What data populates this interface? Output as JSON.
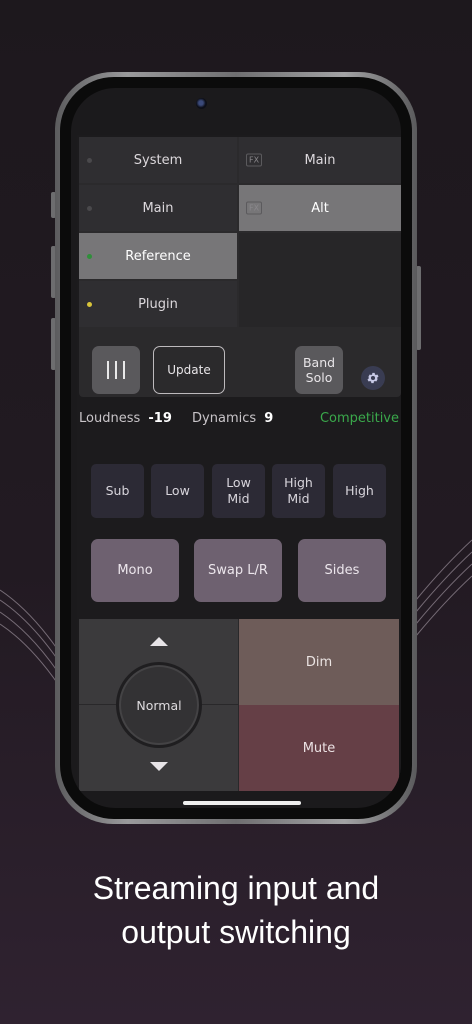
{
  "outputs": {
    "left": [
      {
        "label": "System",
        "dot": "grey"
      },
      {
        "label": "Main",
        "dot": "grey"
      },
      {
        "label": "Reference",
        "dot": "green",
        "selected": true
      },
      {
        "label": "Plugin",
        "dot": "yellow"
      }
    ],
    "right": [
      {
        "label": "Main",
        "badge": "FX"
      },
      {
        "label": "Alt",
        "badge": "FX",
        "selected": true
      }
    ]
  },
  "controls": {
    "update_label": "Update",
    "band_solo_line1": "Band",
    "band_solo_line2": "Solo"
  },
  "stats": {
    "loudness_label": "Loudness",
    "loudness_value": "-19",
    "dynamics_label": "Dynamics",
    "dynamics_value": "9",
    "profile": "Competitive"
  },
  "bands": [
    {
      "line1": "Sub",
      "line2": ""
    },
    {
      "line1": "Low",
      "line2": ""
    },
    {
      "line1": "Low",
      "line2": "Mid"
    },
    {
      "line1": "High",
      "line2": "Mid"
    },
    {
      "line1": "High",
      "line2": ""
    }
  ],
  "modes": [
    "Mono",
    "Swap L/R",
    "Sides"
  ],
  "volume": {
    "knob_label": "Normal"
  },
  "actions": {
    "dim_label": "Dim",
    "mute_label": "Mute"
  },
  "caption": {
    "line1": "Streaming input and",
    "line2": "output switching"
  },
  "colors": {
    "accent_green": "#3aa84b",
    "dim": "#6e5c59",
    "mute": "#653f46",
    "mode": "#6e6170"
  }
}
